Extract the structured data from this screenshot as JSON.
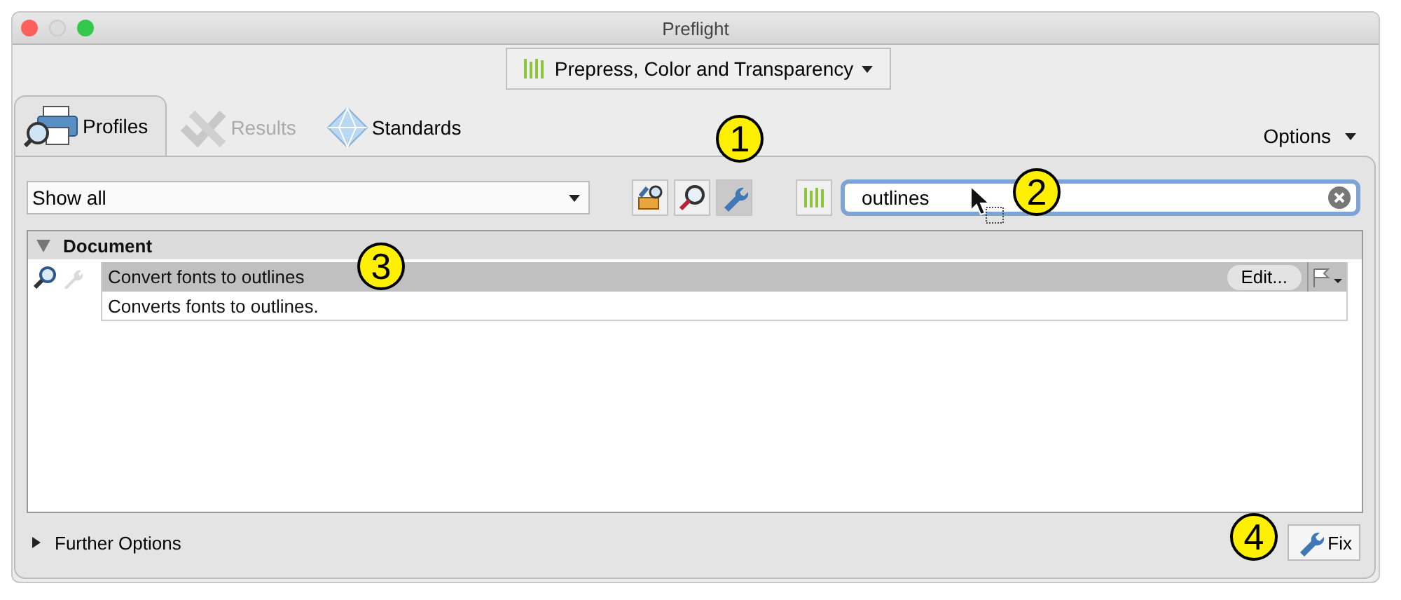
{
  "window": {
    "title": "Preflight"
  },
  "preset": {
    "label": "Prepress, Color and Transparency"
  },
  "tabs": [
    {
      "label": "Profiles",
      "selected": true,
      "disabled": false,
      "kind": "profiles"
    },
    {
      "label": "Results",
      "selected": false,
      "disabled": true,
      "kind": "results"
    },
    {
      "label": "Standards",
      "selected": false,
      "disabled": false,
      "kind": "standards"
    }
  ],
  "options_menu": {
    "label": "Options"
  },
  "filter": {
    "value": "Show all"
  },
  "filter_buttons": [
    {
      "kind": "profiles",
      "selected": false
    },
    {
      "kind": "checks",
      "selected": false
    },
    {
      "kind": "fixups",
      "selected": true
    }
  ],
  "search": {
    "value": "outlines"
  },
  "tree": [
    {
      "label": "Document",
      "expanded": true,
      "children": [
        {
          "label": "Convert fonts to outlines",
          "selected": true,
          "description": "Converts fonts to outlines.",
          "edit_label": "Edit..."
        }
      ]
    }
  ],
  "further_options": {
    "label": "Further Options",
    "expanded": false
  },
  "fix_button": {
    "label": "Fix"
  },
  "callouts": [
    {
      "label": "1",
      "kind": "filter"
    },
    {
      "label": "2",
      "kind": "search"
    },
    {
      "label": "3",
      "kind": "row"
    },
    {
      "label": "4",
      "kind": "fix"
    }
  ]
}
